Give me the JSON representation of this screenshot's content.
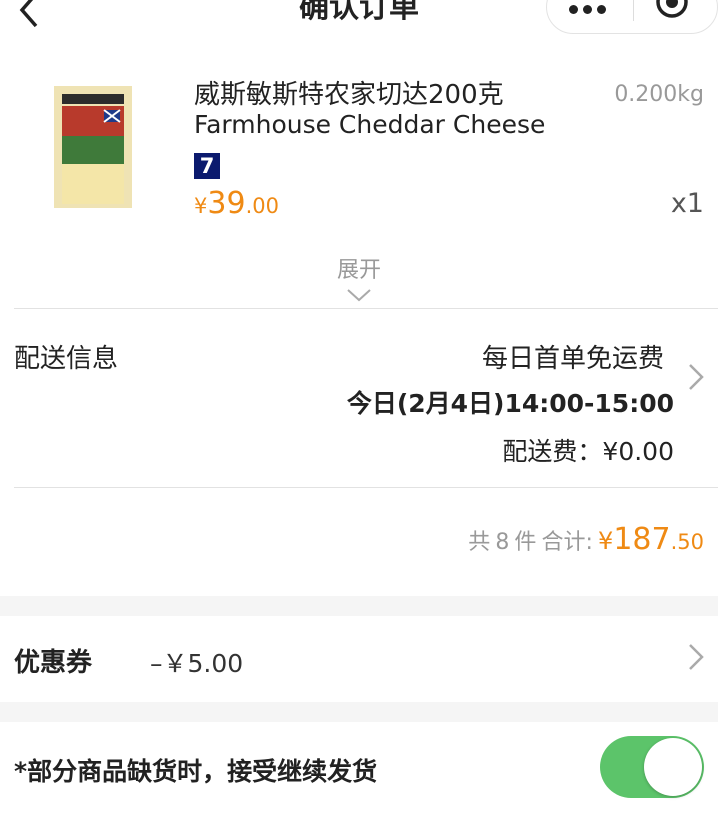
{
  "header": {
    "title": "确认订单",
    "back_icon": "chevron-left-icon",
    "more_icon": "more-dots-icon",
    "close_icon": "target-circle-icon"
  },
  "product": {
    "name_cn": "威斯敏斯特农家切达200克",
    "name_en": "Farmhouse Cheddar Cheese",
    "weight": "0.200kg",
    "tag": "7",
    "price_currency": "¥",
    "price_int": "39",
    "price_dec": ".00",
    "quantity": "x1",
    "expand_label": "展开"
  },
  "delivery": {
    "label": "配送信息",
    "promo": "每日首单免运费",
    "time": "今日(2月4日)14:00-15:00",
    "fee": "配送费：¥0.00"
  },
  "summary": {
    "count_prefix": "共",
    "count": "8",
    "count_suffix": "件",
    "total_label": "合计:",
    "currency": "¥",
    "total_int": "187",
    "total_dec": ".50"
  },
  "coupon": {
    "label": "优惠券",
    "value": "–￥5.00"
  },
  "stock": {
    "label": "*部分商品缺货时，接受继续发货",
    "toggle_on": true
  },
  "colors": {
    "accent": "#ef8a14",
    "toggle": "#5cc46a",
    "tag_bg": "#0b1a6e"
  }
}
